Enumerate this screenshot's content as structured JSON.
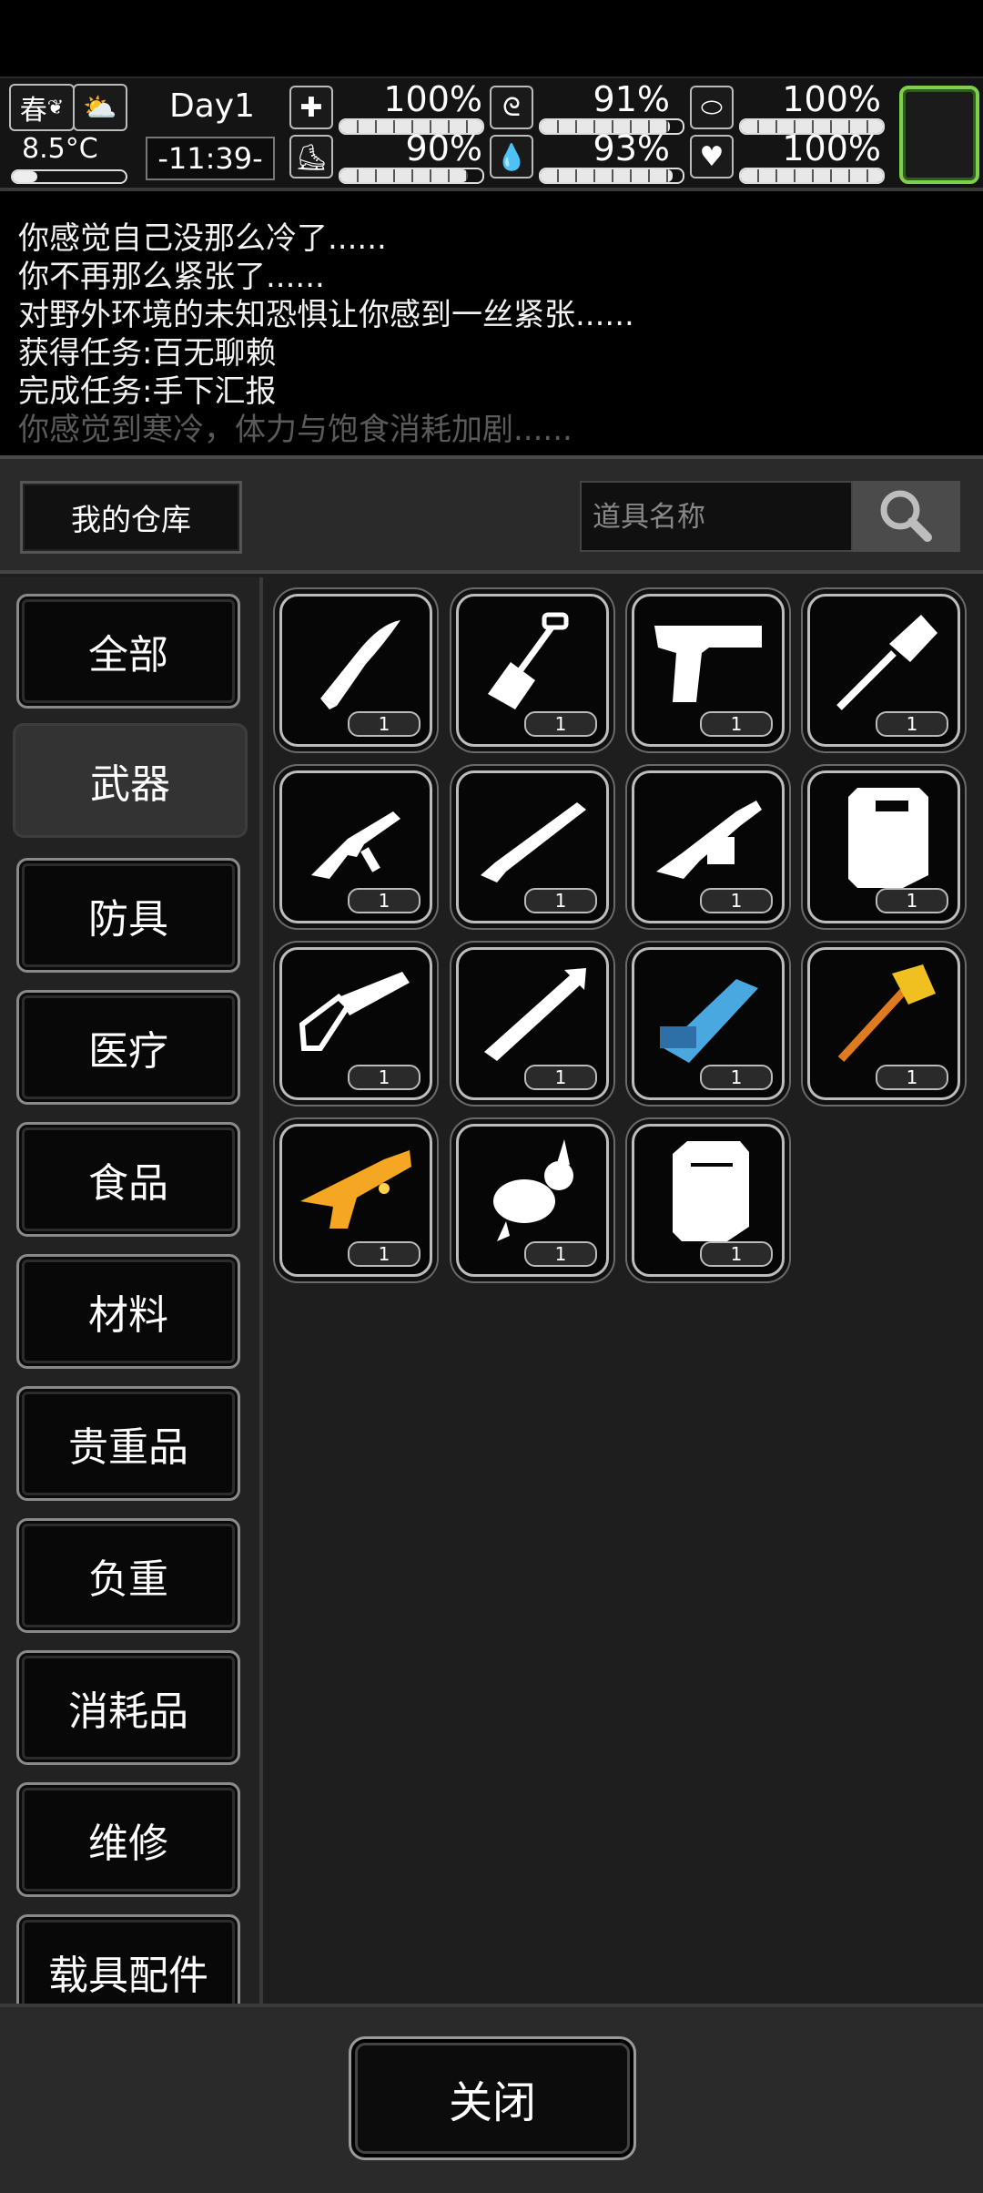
{
  "status": {
    "season": "春",
    "temperature": "8.5°C",
    "day": "Day1",
    "time": "-11:39-",
    "stats": [
      {
        "name": "health",
        "icon": "medkit-icon",
        "value_text": "100%",
        "value": 1.0
      },
      {
        "name": "hunger",
        "icon": "stomach-icon",
        "value_text": "91%",
        "value": 0.91
      },
      {
        "name": "sanity",
        "icon": "pill-icon",
        "value_text": "100%",
        "value": 1.0
      },
      {
        "name": "stamina",
        "icon": "boot-icon",
        "value_text": "90%",
        "value": 0.9
      },
      {
        "name": "thirst",
        "icon": "water-drop-icon",
        "value_text": "93%",
        "value": 0.93
      },
      {
        "name": "mood",
        "icon": "heart-icon",
        "value_text": "100%",
        "value": 1.0
      }
    ],
    "weather_icon": "partly-cloudy-icon"
  },
  "log": {
    "lines": [
      "你感觉自己没那么冷了......",
      "你不再那么紧张了......",
      "对野外环境的未知恐惧让你感到一丝紧张......",
      "获得任务:百无聊赖",
      "完成任务:手下汇报",
      "你感觉到寒冷，体力与饱食消耗加剧......"
    ]
  },
  "warehouse": {
    "title": "我的仓库",
    "search_placeholder": "道具名称"
  },
  "categories": [
    {
      "label": "全部",
      "active": false
    },
    {
      "label": "武器",
      "active": true
    },
    {
      "label": "防具",
      "active": false
    },
    {
      "label": "医疗",
      "active": false
    },
    {
      "label": "食品",
      "active": false
    },
    {
      "label": "材料",
      "active": false
    },
    {
      "label": "贵重品",
      "active": false
    },
    {
      "label": "负重",
      "active": false
    },
    {
      "label": "消耗品",
      "active": false
    },
    {
      "label": "维修",
      "active": false
    },
    {
      "label": "载具配件",
      "active": false
    }
  ],
  "items": [
    {
      "icon": "knife-icon",
      "qty": "1",
      "color": "#ffffff"
    },
    {
      "icon": "shovel-icon",
      "qty": "1",
      "color": "#ffffff"
    },
    {
      "icon": "pistol-icon",
      "qty": "1",
      "color": "#ffffff"
    },
    {
      "icon": "spade-icon",
      "qty": "1",
      "color": "#ffffff"
    },
    {
      "icon": "submachine-gun-icon",
      "qty": "1",
      "color": "#ffffff"
    },
    {
      "icon": "shotgun-icon",
      "qty": "1",
      "color": "#ffffff"
    },
    {
      "icon": "grenade-launcher-rifle-icon",
      "qty": "1",
      "color": "#ffffff"
    },
    {
      "icon": "riot-shield-icon",
      "qty": "1",
      "color": "#ffffff"
    },
    {
      "icon": "chainsaw-icon",
      "qty": "1",
      "color": "#ffffff"
    },
    {
      "icon": "rocket-launcher-icon",
      "qty": "1",
      "color": "#ffffff"
    },
    {
      "icon": "minigun-icon",
      "qty": "1",
      "color": "#4aa8e0"
    },
    {
      "icon": "sledgehammer-icon",
      "qty": "1",
      "color": "#f0a020"
    },
    {
      "icon": "toy-blaster-icon",
      "qty": "1",
      "color": "#f5a623"
    },
    {
      "icon": "rabbit-icon",
      "qty": "1",
      "color": "#ffffff"
    },
    {
      "icon": "armor-plate-icon",
      "qty": "1",
      "color": "#ffffff"
    }
  ],
  "footer": {
    "close_label": "关闭"
  }
}
